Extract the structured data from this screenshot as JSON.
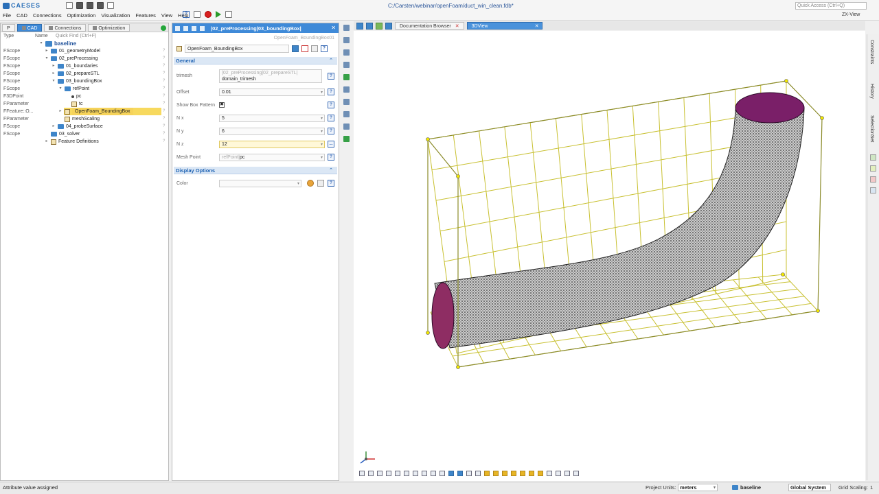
{
  "app": {
    "logo_text": "CAESES",
    "window_title": "C:/Carsten/webinar/openFoam/duct_win_clean.fdb*",
    "quick_access_placeholder": "Quick Access (Ctrl+Q)",
    "view_mode_label": "ZX-View"
  },
  "menu": {
    "items": [
      "File",
      "CAD",
      "Connections",
      "Optimization",
      "Visualization",
      "Features",
      "View",
      "Help"
    ]
  },
  "tree": {
    "tabs": [
      {
        "label": "P",
        "active": false
      },
      {
        "label": "CAD",
        "active": true
      },
      {
        "label": "Connections",
        "active": false
      },
      {
        "label": "Optimization",
        "active": false
      }
    ],
    "header": {
      "type": "Type",
      "name": "Name",
      "quick_find": "Quick Find (Ctrl+F)"
    },
    "root": "baseline",
    "rows": [
      {
        "type": "FScope",
        "label": "01_geometryModel",
        "indent": 0,
        "exp": "▸",
        "icon": "folder"
      },
      {
        "type": "FScope",
        "label": "02_preProcessing",
        "indent": 0,
        "exp": "▾",
        "icon": "folder"
      },
      {
        "type": "FScope",
        "label": "01_boundaries",
        "indent": 1,
        "exp": "▸",
        "icon": "folder"
      },
      {
        "type": "FScope",
        "label": "02_prepareSTL",
        "indent": 1,
        "exp": "▸",
        "icon": "folder"
      },
      {
        "type": "FScope",
        "label": "03_boundingBox",
        "indent": 1,
        "exp": "▾",
        "icon": "folder"
      },
      {
        "type": "FScope",
        "label": "refPoint",
        "indent": 2,
        "exp": "▾",
        "icon": "folder"
      },
      {
        "type": "F3DPoint",
        "label": "pc",
        "indent": 3,
        "exp": "",
        "icon": "dot"
      },
      {
        "type": "FParameter",
        "label": "tc",
        "indent": 3,
        "exp": "",
        "icon": "param"
      },
      {
        "type": "FFeature::O...",
        "label": "OpenFoam_BoundingBox",
        "indent": 2,
        "exp": "▸",
        "icon": "feature",
        "selected": true
      },
      {
        "type": "FParameter",
        "label": "meshScaling",
        "indent": 2,
        "exp": "",
        "icon": "param"
      },
      {
        "type": "FScope",
        "label": "04_probeSurface",
        "indent": 1,
        "exp": "▸",
        "icon": "folder"
      },
      {
        "type": "FScope",
        "label": "03_solver",
        "indent": 0,
        "exp": "",
        "icon": "folder"
      },
      {
        "type": "",
        "label": "Feature Definitions",
        "indent": 0,
        "exp": "▸",
        "icon": "feature"
      }
    ]
  },
  "props": {
    "breadcrumb": "|02_preProcessing|03_boundingBox|",
    "subtitle": "OpenFoam_BoundingBox01",
    "feature_name": "OpenFoam_BoundingBox",
    "general_label": "General",
    "trimesh_label": "trimesh",
    "trimesh_ghost": "|02_preProcessing|02_prepareSTL|",
    "trimesh_value": "domain_trimesh",
    "offset_label": "Offset",
    "offset_value": "0.01",
    "show_box_label": "Show Box Pattern",
    "show_box_checked": "✖",
    "nx_label": "N x",
    "nx_value": "5",
    "ny_label": "N y",
    "ny_value": "6",
    "nz_label": "N z",
    "nz_value": "12",
    "mesh_point_label": "Mesh Point",
    "mesh_point_ghost": "refPoint|",
    "mesh_point_value": "pc",
    "display_label": "Display Options",
    "color_label": "Color",
    "help_glyph": "?",
    "more_glyph": "..."
  },
  "viewport": {
    "tabs": [
      {
        "label": "Documentation Browser",
        "active": false
      },
      {
        "label": "3DView",
        "active": true
      }
    ],
    "colors": {
      "mesh": "#2b2b2b",
      "box": "#c8c030",
      "cap": "#7a1f68",
      "point": "#f3e800"
    }
  },
  "right_dock": {
    "labels": [
      "Constraints",
      "History",
      "SelectionSet"
    ]
  },
  "status": {
    "message": "Attribute value assigned",
    "units_label": "Project Units:",
    "units_value": "meters",
    "scope": "baseline",
    "system": "Global System",
    "grid_label": "Grid Scaling:",
    "grid_value": "1"
  }
}
